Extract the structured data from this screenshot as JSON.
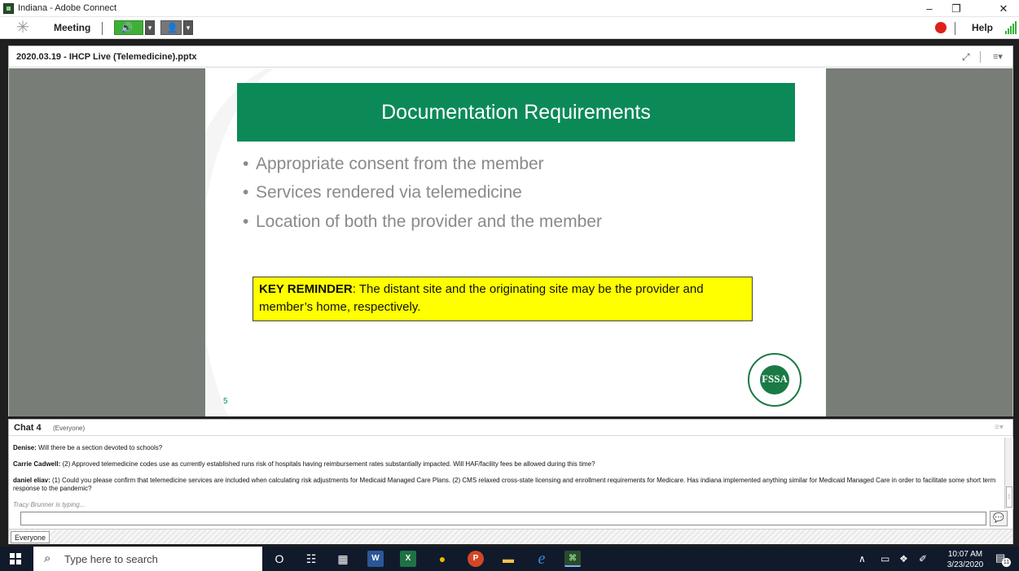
{
  "window": {
    "title": "Indiana - Adobe Connect",
    "minimize": "–",
    "maximize": "❐",
    "close": "✕"
  },
  "menubar": {
    "meeting": "Meeting",
    "help": "Help",
    "speaker_glyph": "🔊",
    "camera_glyph": "👤",
    "dropdown_glyph": "▾",
    "recording_color": "#e0201b"
  },
  "share_pod": {
    "filename": "2020.03.19 - IHCP Live (Telemedicine).pptx",
    "fit_glyph": "⤢",
    "menu_glyph": "≡▾"
  },
  "slide": {
    "title": "Documentation Requirements",
    "bullets": [
      "Appropriate consent from the member",
      "Services rendered via telemedicine",
      "Location of both the provider and the member"
    ],
    "bullet_glyph": "•",
    "reminder_label": "KEY REMINDER",
    "reminder_text": ": The distant site and the originating site may be the provider and member’s home, respectively.",
    "page_number": "5",
    "seal_letters": "FSSA",
    "brand_color": "#0b8a58"
  },
  "chat": {
    "title": "Chat 4",
    "audience": "(Everyone)",
    "menu_glyph": "≡▾",
    "messages": [
      {
        "author": "Denise:",
        "text": " Will there be a section devoted to schools?"
      },
      {
        "author": "Carrie Cadwell:",
        "text": " (2) Approved telemedicine codes use as currently established runs risk of hospitals having reimbursement rates substantially impacted. Will HAF/facility fees be allowed during this time?"
      },
      {
        "author": "daniel eliav:",
        "text": " (1)  Could you please confirm that telemedicine services are included when calculating risk adjustments for Medicaid Managed Care Plans. (2)    CMS relaxed cross-state licensing and enrollment requirements for Medicare.  Has indiana implemented anything similar for Medicaid Managed Care in order to facilitate some short term response to the pandemic?"
      }
    ],
    "typing": "Tracy Brunner is typing...",
    "input_value": "",
    "send_glyph": "💬",
    "tab_everyone": "Everyone"
  },
  "taskbar": {
    "search_placeholder": "Type here to search",
    "search_glyph": "⌕",
    "cortana_glyph": "O",
    "taskview_glyph": "☷",
    "calc_glyph": "▦",
    "word_glyph": "W",
    "excel_glyph": "X",
    "chrome_glyph": "●",
    "ppt_glyph": "P",
    "explorer_glyph": "▬",
    "edge_glyph": "e",
    "connect_glyph": "⌘",
    "tray_up": "∧",
    "tray_net": "▭",
    "tray_dropbox": "❖",
    "tray_pen": "✐",
    "time": "10:07 AM",
    "date": "3/23/2020",
    "notif_count": "11"
  }
}
